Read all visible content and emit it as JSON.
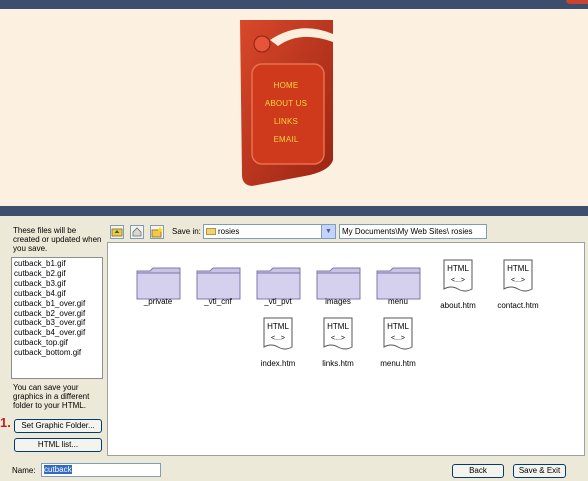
{
  "preview": {
    "menu_links": [
      "HOME",
      "ABOUT US",
      "LINKS",
      "EMAIL"
    ]
  },
  "left_panel": {
    "info_text": "These files will be created or updated when you save.",
    "files": [
      "cutback_b1.gif",
      "cutback_b2.gif",
      "cutback_b3.gif",
      "cutback_b4.gif",
      "cutback_b1_over.gif",
      "cutback_b2_over.gif",
      "cutback_b3_over.gif",
      "cutback_b4_over.gif",
      "cutback_top.gif",
      "cutback_bottom.gif"
    ],
    "hint_text": "You can save your graphics in a different folder to your HTML.",
    "step_number": "1.",
    "set_graphic_folder_label": "Set Graphic Folder...",
    "html_list_label": "HTML list..."
  },
  "toolbar": {
    "save_in_label": "Save in:",
    "save_in_value": "rosies",
    "path_value": "My Documents\\My Web Sites\\ rosies"
  },
  "browser": {
    "folders": [
      "_private",
      "_vti_cnf",
      "_vti_pvt",
      "images",
      "menu"
    ],
    "html_files": [
      "about.htm",
      "contact.htm",
      "index.htm",
      "links.htm",
      "menu.htm"
    ],
    "html_icon_text": "HTML",
    "html_icon_subtext": "<...>"
  },
  "footer": {
    "name_label": "Name:",
    "name_value": "cutback",
    "back_label": "Back",
    "save_exit_label": "Save & Exit"
  },
  "colors": {
    "title_bar": "#3d4d6e",
    "preview_bg": "#fcf1e1",
    "menu_red": "#c53a1f",
    "menu_text": "#f5d640",
    "dialog_bg": "#ece9d8",
    "step_red": "#c22020"
  }
}
